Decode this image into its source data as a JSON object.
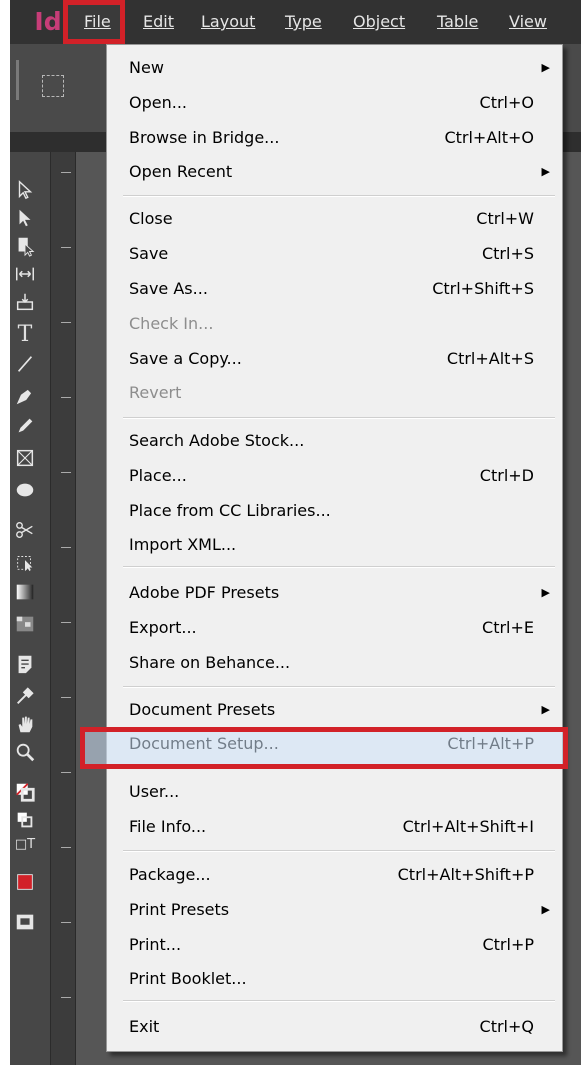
{
  "app": {
    "logo": "Id",
    "brand_color": "#c73d78",
    "highlight_color": "#d22128"
  },
  "menubar": {
    "items": [
      {
        "label": "File",
        "state": "open"
      },
      {
        "label": "Edit"
      },
      {
        "label": "Layout"
      },
      {
        "label": "Type"
      },
      {
        "label": "Object"
      },
      {
        "label": "Table"
      },
      {
        "label": "View"
      }
    ]
  },
  "toolbar": {
    "tools": [
      "selection-tool-icon",
      "direct-selection-tool-icon",
      "page-tool-icon",
      "gap-tool-icon",
      "content-collector-icon",
      "type-tool-icon",
      "line-tool-icon",
      "pen-tool-icon",
      "pencil-tool-icon",
      "rectangle-frame-tool-icon",
      "ellipse-tool-icon",
      "scissors-tool-icon",
      "free-transform-tool-icon",
      "gradient-swatch-tool-icon",
      "gradient-feather-tool-icon",
      "note-tool-icon",
      "eyedropper-tool-icon",
      "hand-tool-icon",
      "zoom-tool-icon",
      "fill-stroke-icon",
      "default-colors-icon",
      "formatting-affects-icon",
      "apply-color-icon",
      "screen-mode-icon"
    ]
  },
  "file_menu": {
    "items": [
      {
        "label": "New",
        "shortcut": "",
        "submenu": true
      },
      {
        "label": "Open...",
        "shortcut": "Ctrl+O"
      },
      {
        "label": "Browse in Bridge...",
        "shortcut": "Ctrl+Alt+O"
      },
      {
        "label": "Open Recent",
        "shortcut": "",
        "submenu": true
      },
      {
        "label": "Close",
        "shortcut": "Ctrl+W"
      },
      {
        "label": "Save",
        "shortcut": "Ctrl+S"
      },
      {
        "label": "Save As...",
        "shortcut": "Ctrl+Shift+S"
      },
      {
        "label": "Check In...",
        "shortcut": "",
        "disabled": true
      },
      {
        "label": "Save a Copy...",
        "shortcut": "Ctrl+Alt+S"
      },
      {
        "label": "Revert",
        "shortcut": "",
        "disabled": true
      },
      {
        "label": "Search Adobe Stock...",
        "shortcut": ""
      },
      {
        "label": "Place...",
        "shortcut": "Ctrl+D"
      },
      {
        "label": "Place from CC Libraries...",
        "shortcut": ""
      },
      {
        "label": "Import XML...",
        "shortcut": ""
      },
      {
        "label": "Adobe PDF Presets",
        "shortcut": "",
        "submenu": true
      },
      {
        "label": "Export...",
        "shortcut": "Ctrl+E"
      },
      {
        "label": "Share on Behance...",
        "shortcut": ""
      },
      {
        "label": "Document Presets",
        "shortcut": "",
        "submenu": true
      },
      {
        "label": "Document Setup...",
        "shortcut": "Ctrl+Alt+P",
        "highlighted": true
      },
      {
        "label": "User...",
        "shortcut": ""
      },
      {
        "label": "File Info...",
        "shortcut": "Ctrl+Alt+Shift+I"
      },
      {
        "label": "Package...",
        "shortcut": "Ctrl+Alt+Shift+P"
      },
      {
        "label": "Print Presets",
        "shortcut": "",
        "submenu": true
      },
      {
        "label": "Print...",
        "shortcut": "Ctrl+P"
      },
      {
        "label": "Print Booklet...",
        "shortcut": ""
      },
      {
        "label": "Exit",
        "shortcut": "Ctrl+Q"
      }
    ]
  }
}
